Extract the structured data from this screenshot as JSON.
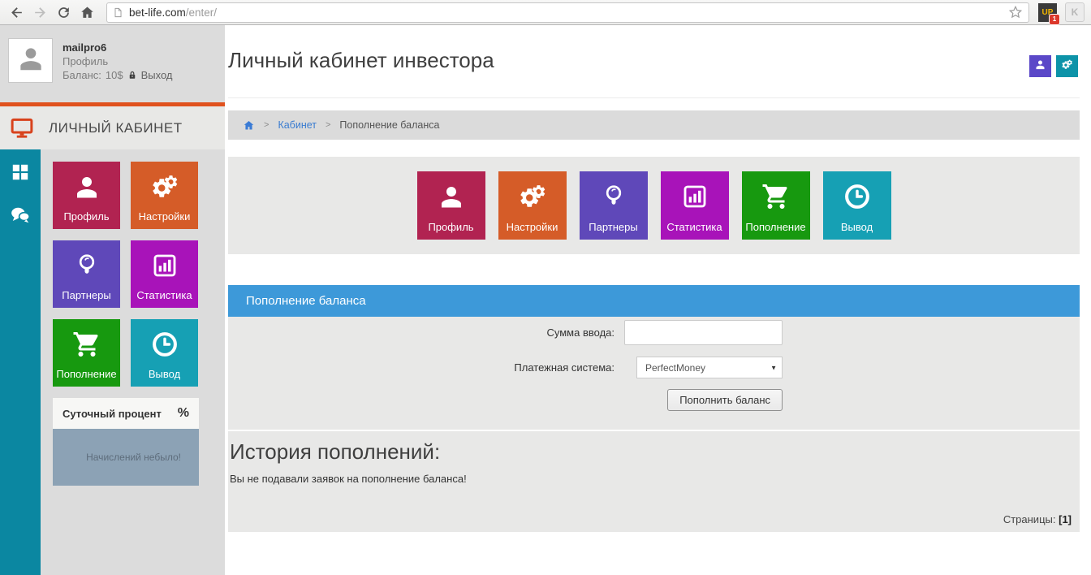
{
  "browser": {
    "url_host": "bet-life.com",
    "url_path": "/enter/",
    "extension_up_label": "UP",
    "extension_up_badge": "1",
    "extension_k_label": "K"
  },
  "user": {
    "name": "mailpro6",
    "profile_link": "Профиль",
    "balance_label": "Баланс:",
    "balance_value": "10$",
    "logout_label": "Выход"
  },
  "sidebar": {
    "title": "ЛИЧНЫЙ КАБИНЕТ",
    "daily": {
      "title": "Суточный процент",
      "percent_symbol": "%",
      "empty_message": "Начислений небыло!"
    }
  },
  "tiles": [
    {
      "id": "profile",
      "label": "Профиль",
      "icon": "user-icon",
      "color": "#b12351"
    },
    {
      "id": "settings",
      "label": "Настройки",
      "icon": "gears-icon",
      "color": "#d55c28"
    },
    {
      "id": "partners",
      "label": "Партнеры",
      "icon": "lightbulb-icon",
      "color": "#5f48b9"
    },
    {
      "id": "statistics",
      "label": "Статистика",
      "icon": "bar-chart-icon",
      "color": "#a813b9"
    },
    {
      "id": "deposit",
      "label": "Пополнение",
      "icon": "cart-icon",
      "color": "#17990f"
    },
    {
      "id": "withdraw",
      "label": "Вывод",
      "icon": "clock-icon",
      "color": "#16a0b4"
    }
  ],
  "main": {
    "title": "Личный кабинет инвестора",
    "breadcrumb": {
      "separator": ">",
      "cabinet_link": "Кабинет",
      "current": "Пополнение баланса"
    },
    "panel": {
      "title": "Пополнение баланса",
      "amount_label": "Сумма ввода:",
      "amount_value": "",
      "payment_label": "Платежная система:",
      "payment_selected": "PerfectMoney",
      "submit_label": "Пополнить баланс"
    },
    "history": {
      "title": "История пополнений:",
      "empty_message": "Вы не подавали заявок на пополнение баланса!",
      "pages_label": "Страницы:",
      "pages_value": "[1]"
    }
  }
}
